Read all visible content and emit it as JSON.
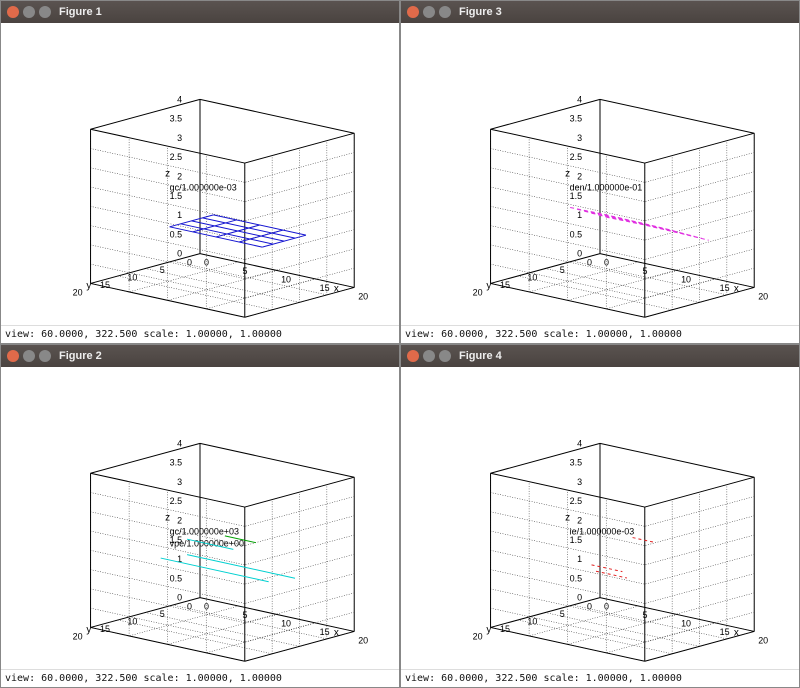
{
  "windows": [
    {
      "id": "f1",
      "title": "Figure 1",
      "status": "view:  60.0000,  322.500    scale:  1.00000,  1.00000",
      "legends": [
        "gc/1.000000e-03"
      ],
      "series_style": "blue"
    },
    {
      "id": "f3",
      "title": "Figure 3",
      "status": "view:  60.0000,  322.500    scale:  1.00000,  1.00000",
      "legends": [
        "den/1.000000e-01"
      ],
      "series_style": "mag"
    },
    {
      "id": "f2",
      "title": "Figure 2",
      "status": "view:  60.0000,  322.500    scale:  1.00000,  1.00000",
      "legends": [
        "gc/1.000000e+03",
        "vpe/1.000000e+00"
      ],
      "series_style": "cyan-green"
    },
    {
      "id": "f4",
      "title": "Figure 4",
      "status": "view:  60.0000,  322.500    scale:  1.00000,  1.00000",
      "legends": [
        "ie/1.000000e-03"
      ],
      "series_style": "red"
    }
  ],
  "axes": {
    "x": {
      "label": "x",
      "ticks": [
        0,
        5,
        10,
        15,
        20
      ]
    },
    "y": {
      "label": "y",
      "ticks": [
        0,
        5,
        10,
        15,
        20
      ]
    },
    "z": {
      "label": "z",
      "ticks": [
        0,
        0.5,
        1,
        1.5,
        2,
        2.5,
        3,
        3.5,
        4
      ]
    }
  },
  "chart_data": [
    {
      "window": "Figure 1",
      "type": "3d-wireframe",
      "xlabel": "x",
      "ylabel": "y",
      "zlabel": "z",
      "x_range": [
        0,
        20
      ],
      "y_range": [
        0,
        20
      ],
      "z_range": [
        0,
        4
      ],
      "series": [
        {
          "name": "gc/1.000000e-03",
          "color": "#1414d0",
          "style": "solid",
          "description": "grid plane at z≈1.5 over x∈[6,18], y∈[6,14]"
        }
      ],
      "view": {
        "elevation": 60.0,
        "azimuth": 322.5
      },
      "scale": [
        1.0,
        1.0
      ]
    },
    {
      "window": "Figure 2",
      "type": "3d-wireframe",
      "xlabel": "x",
      "ylabel": "y",
      "zlabel": "z",
      "x_range": [
        0,
        20
      ],
      "y_range": [
        0,
        20
      ],
      "z_range": [
        0,
        4
      ],
      "series": [
        {
          "name": "gc/1.000000e+03",
          "color": "#00a000",
          "style": "solid",
          "description": "short segment near z≈3 at upper-right"
        },
        {
          "name": "vpe/1.000000e+00",
          "color": "#00d0d0",
          "style": "solid",
          "description": "horizontal lines at z≈1.5–2 spanning x"
        }
      ],
      "view": {
        "elevation": 60.0,
        "azimuth": 322.5
      },
      "scale": [
        1.0,
        1.0
      ]
    },
    {
      "window": "Figure 3",
      "type": "3d-contour",
      "xlabel": "x",
      "ylabel": "y",
      "zlabel": "z",
      "x_range": [
        0,
        20
      ],
      "y_range": [
        0,
        20
      ],
      "z_range": [
        0,
        4
      ],
      "series": [
        {
          "name": "den/1.000000e-01",
          "color": "#e030e0",
          "style": "dashed",
          "description": "dashed contour curves at z≈1.5–2 over mid x,y"
        }
      ],
      "view": {
        "elevation": 60.0,
        "azimuth": 322.5
      },
      "scale": [
        1.0,
        1.0
      ]
    },
    {
      "window": "Figure 4",
      "type": "3d-contour",
      "xlabel": "x",
      "ylabel": "y",
      "zlabel": "z",
      "x_range": [
        0,
        20
      ],
      "y_range": [
        0,
        20
      ],
      "z_range": [
        0,
        4
      ],
      "series": [
        {
          "name": "ie/1.000000e-03",
          "color": "#e02020",
          "style": "dashed",
          "description": "sparse dashed segments at z≈1.5 and z≈3"
        }
      ],
      "view": {
        "elevation": 60.0,
        "azimuth": 322.5
      },
      "scale": [
        1.0,
        1.0
      ]
    }
  ]
}
